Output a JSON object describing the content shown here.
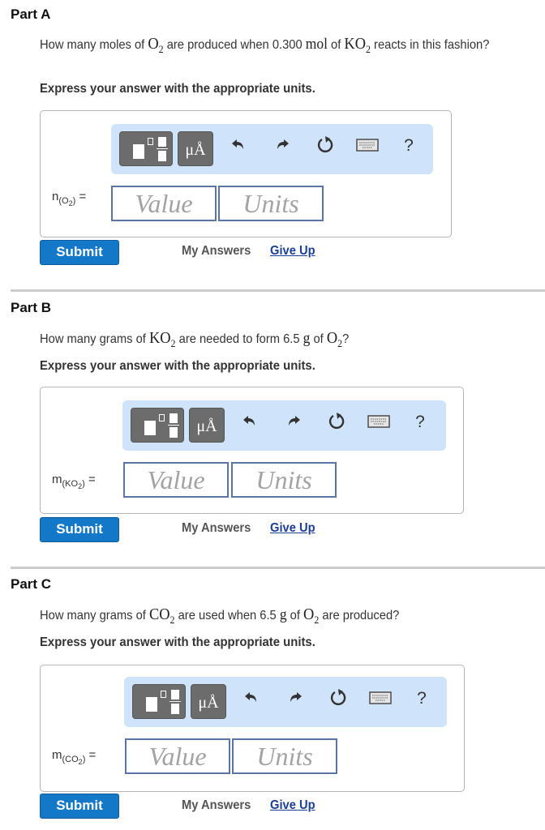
{
  "parts": [
    {
      "title": "Part A",
      "question": {
        "pre": "How many moles of ",
        "chem1": "O",
        "chem1_sub": "2",
        "mid": " are produced when 0.300 ",
        "unit": "mol",
        "mid2": " of ",
        "chem2": "KO",
        "chem2_sub": "2",
        "post": " reacts in this fashion?"
      },
      "instruction": "Express your answer with the appropriate units.",
      "variable": {
        "symbol": "n",
        "species": "O",
        "species_sub": "2",
        "equals": "="
      },
      "value_placeholder": "Value",
      "units_placeholder": "Units",
      "submit_label": "Submit",
      "my_answers_label": "My Answers",
      "give_up_label": "Give Up"
    },
    {
      "title": "Part B",
      "question": {
        "pre": "How many grams of ",
        "chem1": "KO",
        "chem1_sub": "2",
        "mid": " are needed to form 6.5 ",
        "unit": "g",
        "mid2": " of ",
        "chem2": "O",
        "chem2_sub": "2",
        "post": "?"
      },
      "instruction": "Express your answer with the appropriate units.",
      "variable": {
        "symbol": "m",
        "species": "KO",
        "species_sub": "2",
        "equals": "="
      },
      "value_placeholder": "Value",
      "units_placeholder": "Units",
      "submit_label": "Submit",
      "my_answers_label": "My Answers",
      "give_up_label": "Give Up"
    },
    {
      "title": "Part C",
      "question": {
        "pre": "How many grams of ",
        "chem1": "CO",
        "chem1_sub": "2",
        "mid": " are used when 6.5 ",
        "unit": "g",
        "mid2": " of ",
        "chem2": "O",
        "chem2_sub": "2",
        "post": " are produced?"
      },
      "instruction": "Express your answer with the appropriate units.",
      "variable": {
        "symbol": "m",
        "species": "CO",
        "species_sub": "2",
        "equals": "="
      },
      "value_placeholder": "Value",
      "units_placeholder": "Units",
      "submit_label": "Submit",
      "my_answers_label": "My Answers",
      "give_up_label": "Give Up"
    }
  ],
  "toolbar": {
    "units_button_label": "μÅ",
    "help_label": "?",
    "icons": [
      "templates-icon",
      "units-icon",
      "undo-icon",
      "redo-icon",
      "reset-icon",
      "keyboard-icon",
      "help-icon"
    ]
  },
  "colors": {
    "toolbar_bg": "#cfe4fa",
    "button_dark": "#6d6c6c",
    "submit_bg": "#1478c8",
    "link": "#1c3f94",
    "field_border": "#5a75a5"
  }
}
